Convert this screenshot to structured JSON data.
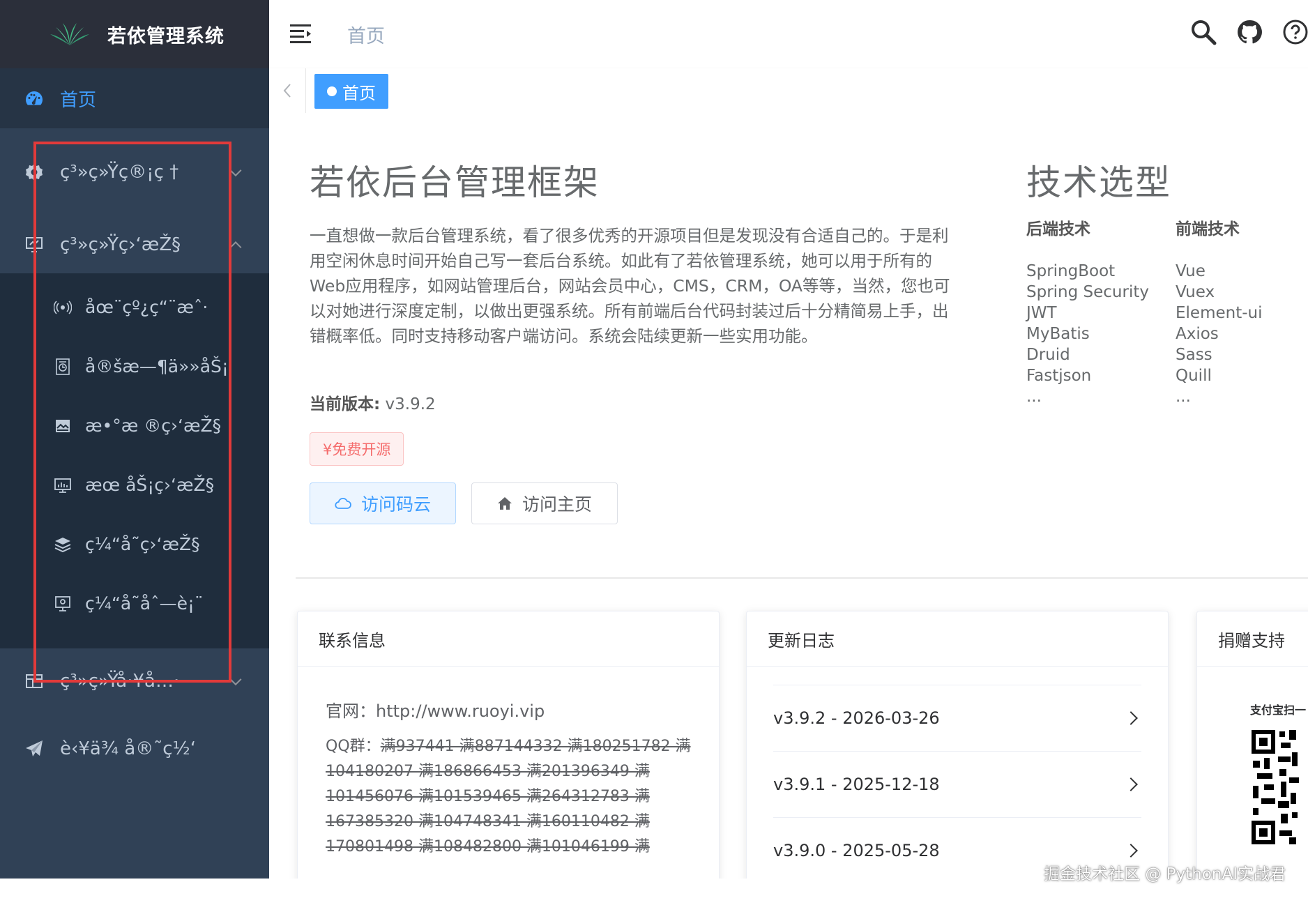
{
  "app": {
    "title": "若依管理系统"
  },
  "sidebar": {
    "home": "首页",
    "items": [
      {
        "label": "ç³»ç»Ÿç®¡ç †",
        "icon": "gear-icon"
      },
      {
        "label": "ç³»ç»Ÿç›‘æŽ§",
        "icon": "monitor-icon"
      }
    ],
    "subitems": [
      {
        "label": "åœ¨çº¿ç“¨æˆ·",
        "icon": "online-icon"
      },
      {
        "label": "å®šæ—¶ä»»åŠ¡",
        "icon": "job-icon"
      },
      {
        "label": "æ•°æ ®ç›‘æŽ§",
        "icon": "druid-icon"
      },
      {
        "label": "æœ åŠ¡ç›‘æŽ§",
        "icon": "server-icon"
      },
      {
        "label": "ç¼“å­˜ç›‘æŽ§",
        "icon": "cache-icon"
      },
      {
        "label": "ç¼“å­˜åˆ—è¡¨",
        "icon": "cache-list-icon"
      }
    ],
    "tool": "ç³»ç»Ÿå·¥å…·",
    "guide": "è‹¥ä¾ å®˜ç½‘"
  },
  "navbar": {
    "breadcrumb": "首页"
  },
  "tags": {
    "active": "首页"
  },
  "intro": {
    "title": "若依后台管理框架",
    "text": "一直想做一款后台管理系统，看了很多优秀的开源项目但是发现没有合适自己的。于是利用空闲休息时间开始自己写一套后台系统。如此有了若依管理系统，她可以用于所有的Web应用程序，如网站管理后台，网站会员中心，CMS，CRM，OA等等，当然，您也可以对她进行深度定制，以做出更强系统。所有前端后台代码封装过后十分精简易上手，出错概率低。同时支持移动客户端访问。系统会陆续更新一些实用功能。",
    "version_label": "当前版本:",
    "version": "v3.9.2",
    "free_tag": "¥免费开源",
    "btn_cloud": "访问码云",
    "btn_home": "访问主页"
  },
  "tech": {
    "title": "技术选型",
    "backend_title": "后端技术",
    "backend": [
      "SpringBoot",
      "Spring Security",
      "JWT",
      "MyBatis",
      "Druid",
      "Fastjson",
      "..."
    ],
    "frontend_title": "前端技术",
    "frontend": [
      "Vue",
      "Vuex",
      "Element-ui",
      "Axios",
      "Sass",
      "Quill",
      "..."
    ]
  },
  "contact": {
    "title": "联系信息",
    "site_label": "官网：",
    "site": "http://www.ruoyi.vip",
    "qq_label": "QQ群：",
    "qq": "满937441 满887144332 满180251782 满104180207 满186866453 满201396349 满101456076 满101539465 满264312783 满167385320 满104748341 满160110482 满170801498 满108482800 满101046199 满"
  },
  "changelog": {
    "title": "更新日志",
    "items": [
      "v3.9.2 - 2026-03-26",
      "v3.9.1 - 2025-12-18",
      "v3.9.0 - 2025-05-28"
    ]
  },
  "donate": {
    "title": "捐赠支持",
    "label": "支付宝扫一"
  },
  "watermark": "掘金技术社区 @ PythonAI实战君",
  "colors": {
    "sidebar": "#304156",
    "sidebar_dark": "#1f2d3d",
    "accent": "#409eff",
    "highlight_box": "#e23a3a"
  }
}
